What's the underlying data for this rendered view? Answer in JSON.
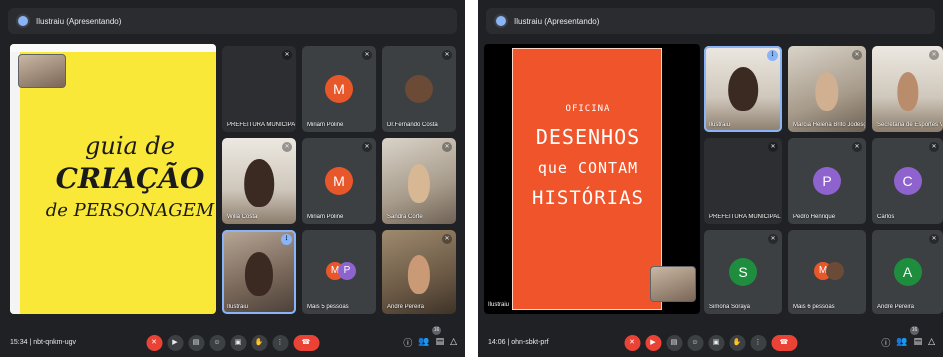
{
  "left": {
    "presenter_title": "Ilustraiu (Apresentando)",
    "meeting_time": "15:34",
    "meeting_code": "nbt-qnkm-ugv",
    "slide_lines": [
      "guia de",
      "CRIAÇÃO",
      "de PERSONAGEM"
    ],
    "tiles": [
      {
        "name": "PREFEITURA MUNICIPAL VA..."
      },
      {
        "name": "Miriam Poline",
        "initial": "M"
      },
      {
        "name": "Dr.Fernando Costa"
      },
      {
        "name": "Willa Costa"
      },
      {
        "name": "Miriam Poline",
        "initial": "M"
      },
      {
        "name": "Sandra Corte"
      },
      {
        "name": "Ilustraiu"
      },
      {
        "name": "Mais 5 pessoas",
        "initials": [
          "M",
          "P"
        ]
      },
      {
        "name": "André Pereira"
      }
    ],
    "participants_count": "16"
  },
  "right": {
    "presenter_title": "Ilustraiu (Apresentando)",
    "meeting_time": "14:06",
    "meeting_code": "ohn-sbkt-prf",
    "slide_lines": [
      "OFICINA",
      "DESENHOS",
      "que CONTAM",
      "HISTÓRIAS"
    ],
    "self_label": "Ilustraiu",
    "tiles": [
      {
        "name": "Ilustraiu"
      },
      {
        "name": "Marcia Helena Brito Jodesg..."
      },
      {
        "name": "Secretaria de Esportes Valp..."
      },
      {
        "name": "PREFEITURA MUNICIPAL VA..."
      },
      {
        "name": "Pedro Henrique",
        "initial": "P"
      },
      {
        "name": "Carlos",
        "initial": "C"
      },
      {
        "name": "Simona Soraya",
        "initial": "S"
      },
      {
        "name": "Mais 6 pessoas",
        "initials": [
          "M"
        ]
      },
      {
        "name": "André Pereira",
        "initial": "A"
      }
    ],
    "participants_count": "16"
  },
  "colors": {
    "meet_bg": "#202124",
    "tile_bg": "#3c4043",
    "hangup_red": "#ea4335",
    "yellow_slide": "#f9e838",
    "orange_slide": "#f0542a",
    "avatar_orange": "#e8572a",
    "avatar_purple": "#8e63ce",
    "avatar_green": "#1e8e3e"
  },
  "icons": [
    "mic-off-icon",
    "camera-off-icon",
    "captions-icon",
    "emoji-icon",
    "present-icon",
    "raise-hand-icon",
    "more-icon",
    "hangup-icon",
    "info-icon",
    "people-icon",
    "chat-icon",
    "activities-icon"
  ]
}
